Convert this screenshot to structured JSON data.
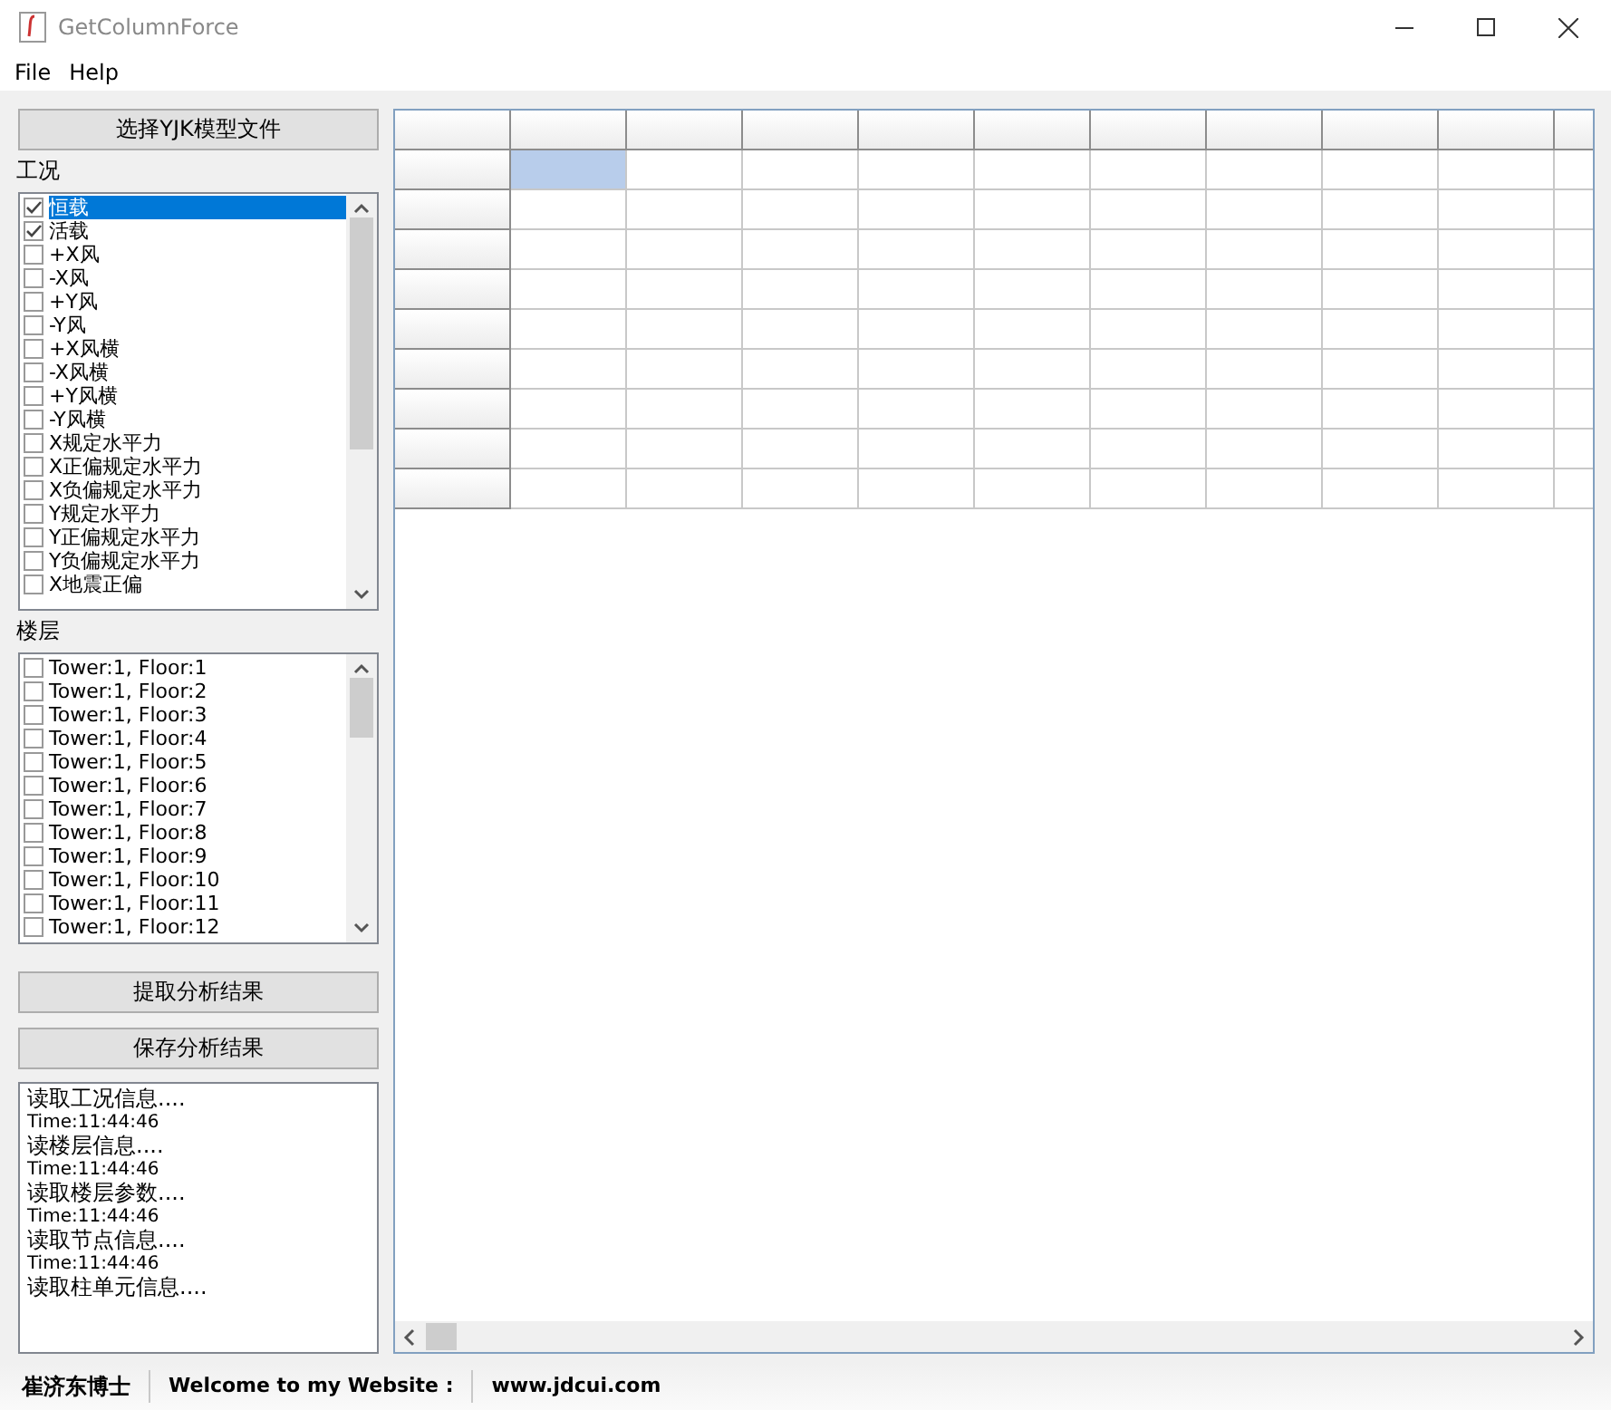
{
  "window": {
    "title": "GetColumnForce"
  },
  "menu": [
    "File",
    "Help"
  ],
  "select_file_button": "选择YJK模型文件",
  "load_cases": {
    "label": "工况",
    "items": [
      {
        "text": "恒载",
        "checked": true,
        "selected": true
      },
      {
        "text": "活载",
        "checked": true,
        "selected": false
      },
      {
        "text": "+X风",
        "checked": false,
        "selected": false
      },
      {
        "text": "-X风",
        "checked": false,
        "selected": false
      },
      {
        "text": "+Y风",
        "checked": false,
        "selected": false
      },
      {
        "text": "-Y风",
        "checked": false,
        "selected": false
      },
      {
        "text": "+X风横",
        "checked": false,
        "selected": false
      },
      {
        "text": "-X风横",
        "checked": false,
        "selected": false
      },
      {
        "text": "+Y风横",
        "checked": false,
        "selected": false
      },
      {
        "text": "-Y风横",
        "checked": false,
        "selected": false
      },
      {
        "text": "X规定水平力",
        "checked": false,
        "selected": false
      },
      {
        "text": "X正偏规定水平力",
        "checked": false,
        "selected": false
      },
      {
        "text": "X负偏规定水平力",
        "checked": false,
        "selected": false
      },
      {
        "text": "Y规定水平力",
        "checked": false,
        "selected": false
      },
      {
        "text": "Y正偏规定水平力",
        "checked": false,
        "selected": false
      },
      {
        "text": "Y负偏规定水平力",
        "checked": false,
        "selected": false
      },
      {
        "text": "X地震正偏",
        "checked": false,
        "selected": false
      }
    ]
  },
  "floors": {
    "label": "楼层",
    "items": [
      {
        "text": "Tower:1, Floor:1",
        "checked": false
      },
      {
        "text": "Tower:1, Floor:2",
        "checked": false
      },
      {
        "text": "Tower:1, Floor:3",
        "checked": false
      },
      {
        "text": "Tower:1, Floor:4",
        "checked": false
      },
      {
        "text": "Tower:1, Floor:5",
        "checked": false
      },
      {
        "text": "Tower:1, Floor:6",
        "checked": false
      },
      {
        "text": "Tower:1, Floor:7",
        "checked": false
      },
      {
        "text": "Tower:1, Floor:8",
        "checked": false
      },
      {
        "text": "Tower:1, Floor:9",
        "checked": false
      },
      {
        "text": "Tower:1, Floor:10",
        "checked": false
      },
      {
        "text": "Tower:1, Floor:11",
        "checked": false
      },
      {
        "text": "Tower:1, Floor:12",
        "checked": false
      }
    ]
  },
  "action_buttons": [
    "提取分析结果",
    "保存分析结果"
  ],
  "log": [
    {
      "kind": "message",
      "text": "读取工况信息...."
    },
    {
      "kind": "time",
      "text": "Time:11:44:46"
    },
    {
      "kind": "message",
      "text": "读楼层信息...."
    },
    {
      "kind": "time",
      "text": "Time:11:44:46"
    },
    {
      "kind": "message",
      "text": "读取楼层参数...."
    },
    {
      "kind": "time",
      "text": "Time:11:44:46"
    },
    {
      "kind": "message",
      "text": "读取节点信息...."
    },
    {
      "kind": "time",
      "text": "Time:11:44:46"
    },
    {
      "kind": "message",
      "text": "读取柱单元信息...."
    }
  ],
  "grid": {
    "rows": [
      {
        "cells": [
          {
            "selected": true
          },
          {
            "selected": false
          },
          {
            "selected": false
          },
          {
            "selected": false
          },
          {
            "selected": false
          },
          {
            "selected": false
          },
          {
            "selected": false
          },
          {
            "selected": false
          },
          {
            "selected": false
          },
          {
            "selected": false
          }
        ]
      },
      {
        "cells": [
          {
            "selected": false
          },
          {
            "selected": false
          },
          {
            "selected": false
          },
          {
            "selected": false
          },
          {
            "selected": false
          },
          {
            "selected": false
          },
          {
            "selected": false
          },
          {
            "selected": false
          },
          {
            "selected": false
          },
          {
            "selected": false
          }
        ]
      },
      {
        "cells": [
          {
            "selected": false
          },
          {
            "selected": false
          },
          {
            "selected": false
          },
          {
            "selected": false
          },
          {
            "selected": false
          },
          {
            "selected": false
          },
          {
            "selected": false
          },
          {
            "selected": false
          },
          {
            "selected": false
          },
          {
            "selected": false
          }
        ]
      },
      {
        "cells": [
          {
            "selected": false
          },
          {
            "selected": false
          },
          {
            "selected": false
          },
          {
            "selected": false
          },
          {
            "selected": false
          },
          {
            "selected": false
          },
          {
            "selected": false
          },
          {
            "selected": false
          },
          {
            "selected": false
          },
          {
            "selected": false
          }
        ]
      },
      {
        "cells": [
          {
            "selected": false
          },
          {
            "selected": false
          },
          {
            "selected": false
          },
          {
            "selected": false
          },
          {
            "selected": false
          },
          {
            "selected": false
          },
          {
            "selected": false
          },
          {
            "selected": false
          },
          {
            "selected": false
          },
          {
            "selected": false
          }
        ]
      },
      {
        "cells": [
          {
            "selected": false
          },
          {
            "selected": false
          },
          {
            "selected": false
          },
          {
            "selected": false
          },
          {
            "selected": false
          },
          {
            "selected": false
          },
          {
            "selected": false
          },
          {
            "selected": false
          },
          {
            "selected": false
          },
          {
            "selected": false
          }
        ]
      },
      {
        "cells": [
          {
            "selected": false
          },
          {
            "selected": false
          },
          {
            "selected": false
          },
          {
            "selected": false
          },
          {
            "selected": false
          },
          {
            "selected": false
          },
          {
            "selected": false
          },
          {
            "selected": false
          },
          {
            "selected": false
          },
          {
            "selected": false
          }
        ]
      },
      {
        "cells": [
          {
            "selected": false
          },
          {
            "selected": false
          },
          {
            "selected": false
          },
          {
            "selected": false
          },
          {
            "selected": false
          },
          {
            "selected": false
          },
          {
            "selected": false
          },
          {
            "selected": false
          },
          {
            "selected": false
          },
          {
            "selected": false
          }
        ]
      },
      {
        "cells": [
          {
            "selected": false
          },
          {
            "selected": false
          },
          {
            "selected": false
          },
          {
            "selected": false
          },
          {
            "selected": false
          },
          {
            "selected": false
          },
          {
            "selected": false
          },
          {
            "selected": false
          },
          {
            "selected": false
          },
          {
            "selected": false
          }
        ]
      }
    ]
  },
  "status_bar": [
    "崔济东博士",
    "Welcome to my Website :",
    "www.jdcui.com"
  ]
}
